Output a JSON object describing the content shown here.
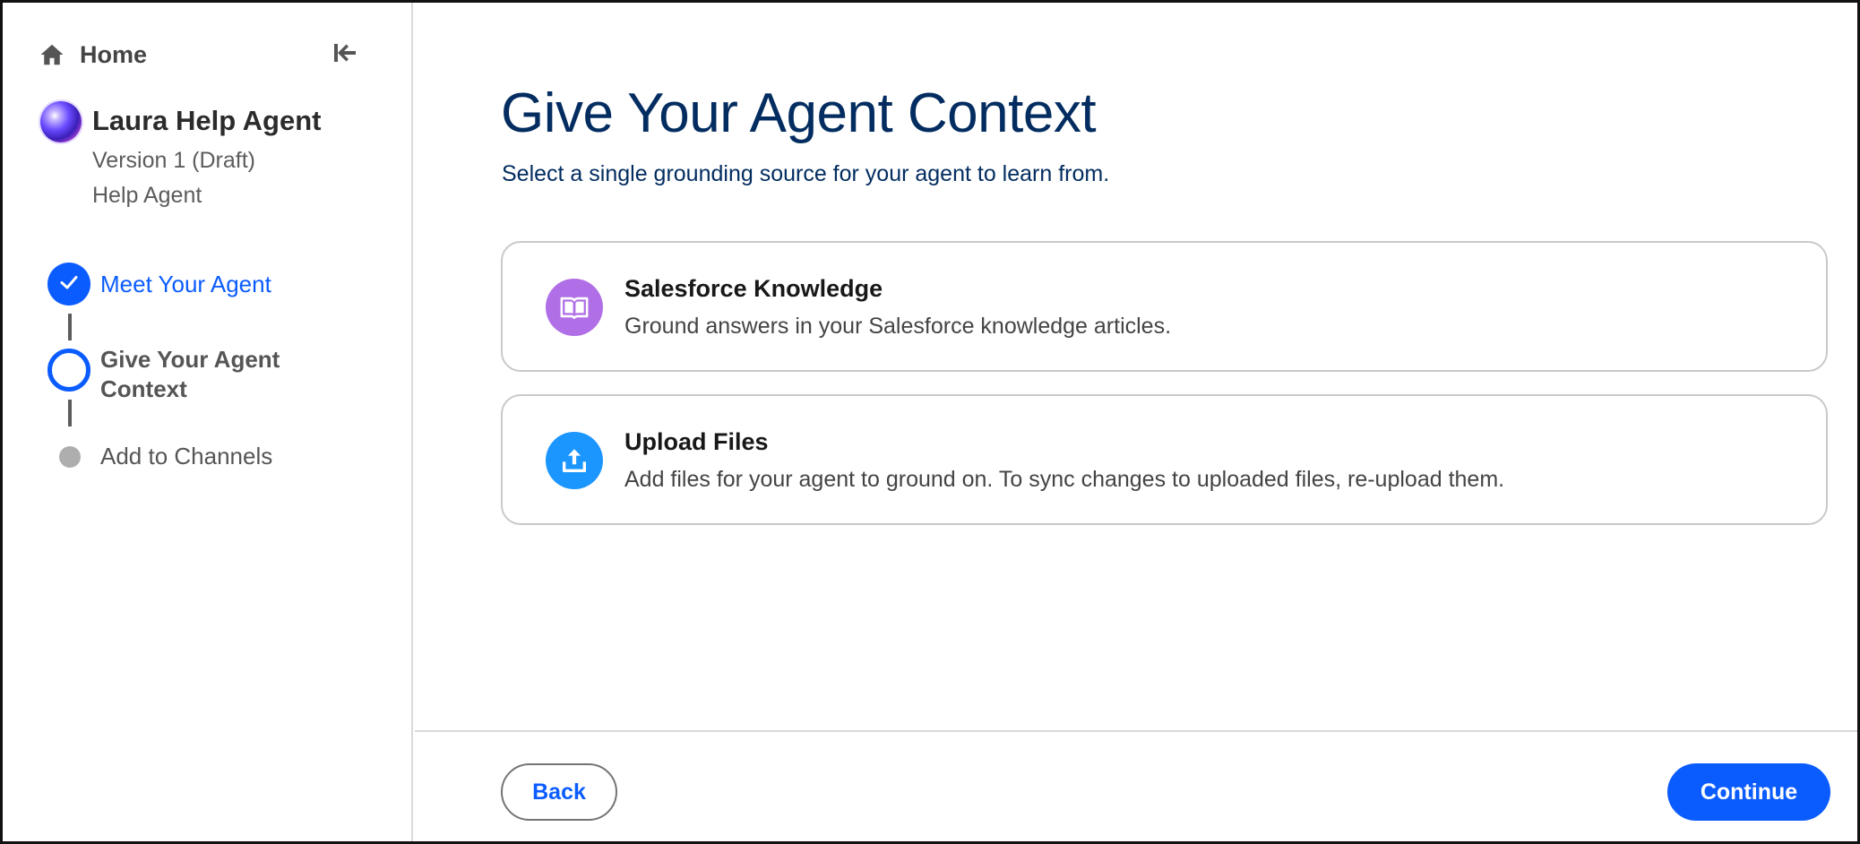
{
  "sidebar": {
    "home_label": "Home",
    "home_icon": "home-icon",
    "collapse_icon": "collapse-left-icon",
    "agent": {
      "name": "Laura Help Agent",
      "version": "Version 1 (Draft)",
      "type": "Help Agent"
    },
    "steps": [
      {
        "label": "Meet Your Agent",
        "status": "complete"
      },
      {
        "label": "Give Your Agent Context",
        "status": "current"
      },
      {
        "label": "Add to Channels",
        "status": "upcoming"
      }
    ]
  },
  "main": {
    "title": "Give Your Agent Context",
    "subtitle": "Select a single grounding source for your agent to learn from.",
    "options": [
      {
        "title": "Salesforce Knowledge",
        "description": "Ground answers in your Salesforce knowledge articles.",
        "icon": "open-book-icon",
        "icon_color": "#b06fe6"
      },
      {
        "title": "Upload Files",
        "description": "Add files for your agent to ground on. To sync changes to uploaded files, re-upload them.",
        "icon": "upload-icon",
        "icon_color": "#1b96ff"
      }
    ]
  },
  "footer": {
    "back_label": "Back",
    "continue_label": "Continue"
  },
  "colors": {
    "brand_blue": "#0b5cff",
    "title_navy": "#032d60"
  }
}
